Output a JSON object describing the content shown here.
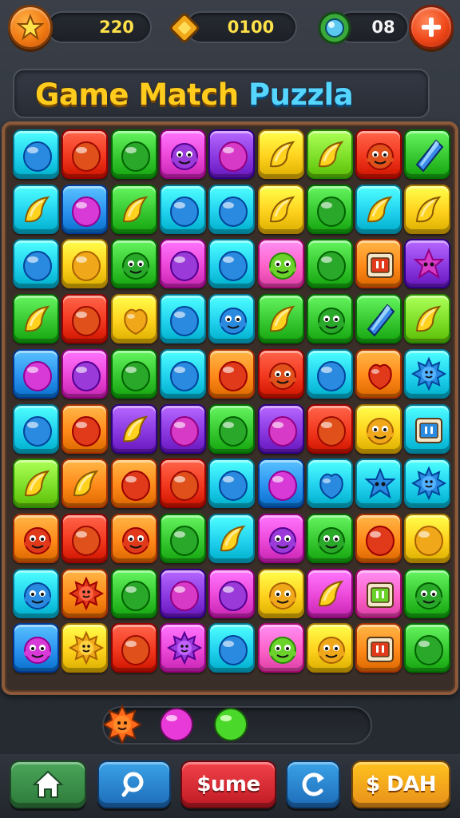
{
  "hud": {
    "star_score": "220",
    "gem_count": "0100",
    "orb_count": "08",
    "star_icon": "star-icon",
    "gem_icon": "diamond-icon",
    "orb_icon": "green-orb-icon",
    "add_icon": "plus-icon"
  },
  "title": {
    "part_one": "Game Match",
    "part_two": "Puzzla"
  },
  "board": {
    "rows": 10,
    "cols": 9,
    "palette": {
      "lime": "#7fe02a",
      "red": "#f2381e",
      "green": "#38c832",
      "magenta": "#ec48d8",
      "purple": "#8a3ae0",
      "yellow": "#ffd21e",
      "cyan": "#22d2ee",
      "blue": "#2c94f0",
      "orange": "#ff8a1a",
      "pink": "#ff62c8"
    },
    "tiles": [
      [
        "cyan",
        "red",
        "green",
        "magenta",
        "purple",
        "yellow",
        "lime",
        "red",
        "green"
      ],
      [
        "cyan",
        "blue",
        "green",
        "cyan",
        "cyan",
        "yellow",
        "green",
        "cyan",
        "yellow"
      ],
      [
        "cyan",
        "yellow",
        "green",
        "magenta",
        "cyan",
        "pink",
        "green",
        "orange",
        "purple"
      ],
      [
        "green",
        "red",
        "yellow",
        "cyan",
        "cyan",
        "green",
        "green",
        "green",
        "lime"
      ],
      [
        "blue",
        "magenta",
        "green",
        "cyan",
        "orange",
        "red",
        "cyan",
        "orange",
        "cyan"
      ],
      [
        "cyan",
        "orange",
        "purple",
        "purple",
        "green",
        "purple",
        "red",
        "yellow",
        "cyan"
      ],
      [
        "lime",
        "orange",
        "orange",
        "red",
        "cyan",
        "blue",
        "cyan",
        "cyan",
        "cyan"
      ],
      [
        "orange",
        "red",
        "orange",
        "green",
        "cyan",
        "magenta",
        "green",
        "orange",
        "yellow"
      ],
      [
        "cyan",
        "orange",
        "green",
        "purple",
        "magenta",
        "yellow",
        "magenta",
        "pink",
        "green"
      ],
      [
        "blue",
        "yellow",
        "red",
        "magenta",
        "cyan",
        "pink",
        "yellow",
        "orange",
        "green"
      ]
    ],
    "pieces": [
      [
        "candy-icon",
        "candy-icon",
        "candy-icon",
        "monster-icon",
        "candy-icon",
        "banana-icon",
        "banana-icon",
        "monster-icon",
        "crystal-icon"
      ],
      [
        "banana-icon",
        "candy-icon",
        "banana-icon",
        "candy-icon",
        "candy-icon",
        "banana-icon",
        "candy-icon",
        "banana-icon",
        "banana-icon"
      ],
      [
        "candy-icon",
        "candy-icon",
        "monster-icon",
        "candy-icon",
        "candy-icon",
        "monster-icon",
        "candy-icon",
        "box-icon",
        "star-blob-icon"
      ],
      [
        "banana-icon",
        "candy-icon",
        "berry-icon",
        "candy-icon",
        "monster-icon",
        "banana-icon",
        "monster-icon",
        "crystal-icon",
        "banana-icon"
      ],
      [
        "candy-icon",
        "candy-icon",
        "candy-icon",
        "candy-icon",
        "candy-icon",
        "monster-icon",
        "candy-icon",
        "berry-icon",
        "sun-icon"
      ],
      [
        "candy-icon",
        "candy-icon",
        "banana-icon",
        "candy-icon",
        "candy-icon",
        "candy-icon",
        "candy-icon",
        "monster-icon",
        "box-icon"
      ],
      [
        "banana-icon",
        "banana-icon",
        "candy-icon",
        "candy-icon",
        "candy-icon",
        "candy-icon",
        "berry-icon",
        "star-blob-icon",
        "sun-icon"
      ],
      [
        "monster-icon",
        "candy-icon",
        "monster-icon",
        "candy-icon",
        "banana-icon",
        "monster-icon",
        "monster-icon",
        "candy-icon",
        "candy-icon"
      ],
      [
        "monster-icon",
        "sun-icon",
        "candy-icon",
        "candy-icon",
        "candy-icon",
        "monster-icon",
        "banana-icon",
        "box-icon",
        "monster-icon"
      ],
      [
        "monster-icon",
        "sun-icon",
        "candy-icon",
        "sun-icon",
        "candy-icon",
        "monster-icon",
        "monster-icon",
        "box-icon",
        "candy-icon"
      ]
    ]
  },
  "powerups": {
    "items": [
      "sun-icon",
      "magenta-orb-icon",
      "green-orb-icon"
    ]
  },
  "nav": {
    "home_icon": "home-icon",
    "search_icon": "search-icon",
    "resume_label": "$ume",
    "refresh_icon": "refresh-icon",
    "shop_label": "$ DAH"
  }
}
